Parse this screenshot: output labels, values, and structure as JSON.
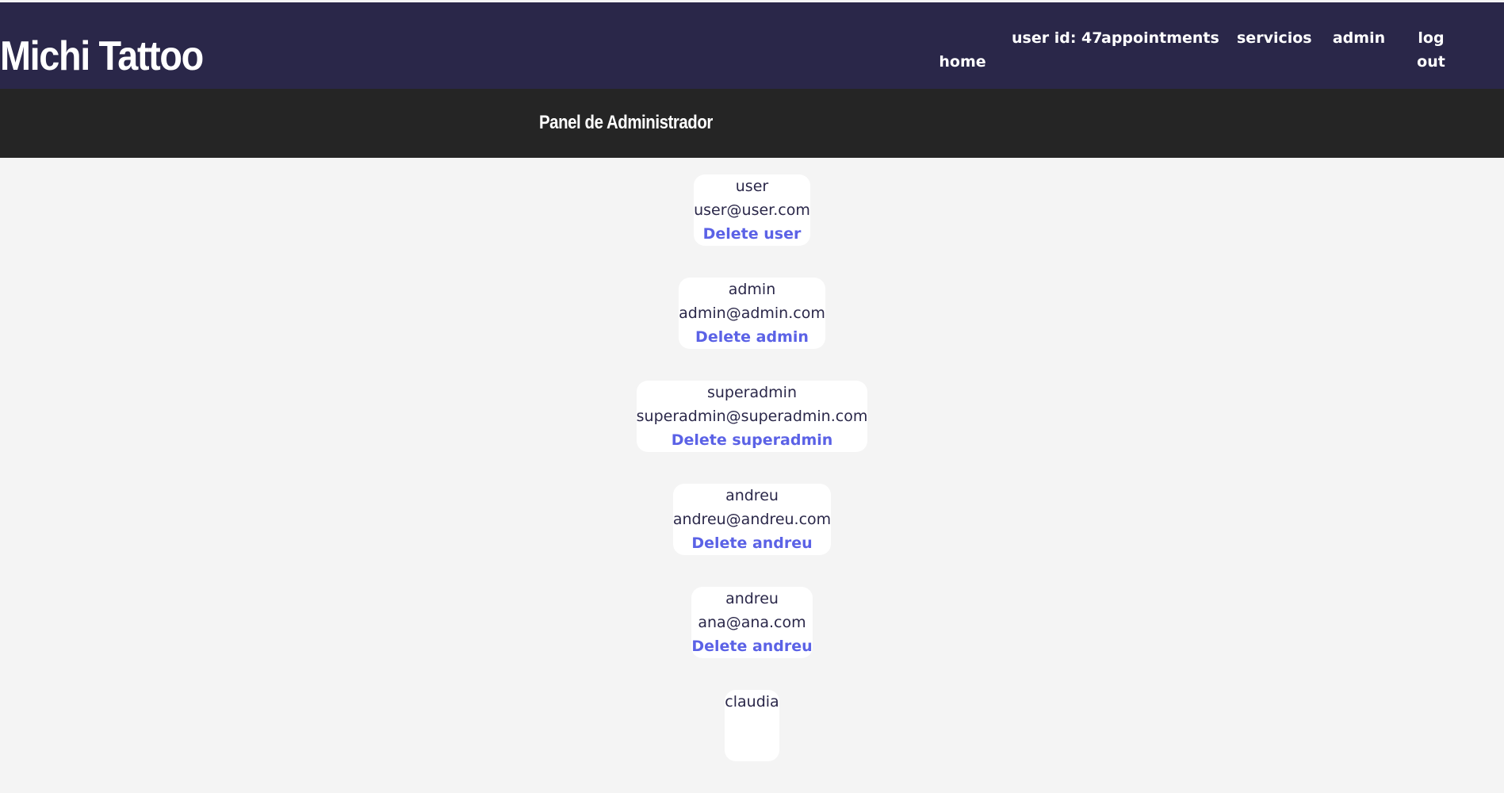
{
  "header": {
    "brand": "Michi Tattoo",
    "nav": {
      "home": "home",
      "user_id_label": "user id: 47",
      "appointments": "appointments",
      "servicios": "servicios",
      "admin": "admin",
      "logout": "log out"
    }
  },
  "panel": {
    "title": "Panel de Administrador"
  },
  "users": [
    {
      "name": "user",
      "email": "user@user.com",
      "delete_label": "Delete user"
    },
    {
      "name": "admin",
      "email": "admin@admin.com",
      "delete_label": "Delete admin"
    },
    {
      "name": "superadmin",
      "email": "superadmin@superadmin.com",
      "delete_label": "Delete superadmin"
    },
    {
      "name": "andreu",
      "email": "andreu@andreu.com",
      "delete_label": "Delete andreu"
    },
    {
      "name": "andreu",
      "email": "ana@ana.com",
      "delete_label": "Delete andreu"
    },
    {
      "name": "claudia",
      "email": "",
      "delete_label": ""
    }
  ],
  "colors": {
    "navbar_bg": "#2a2749",
    "subbar_bg": "#252525",
    "page_bg": "#f4f4f4",
    "link": "#5b62e6"
  }
}
